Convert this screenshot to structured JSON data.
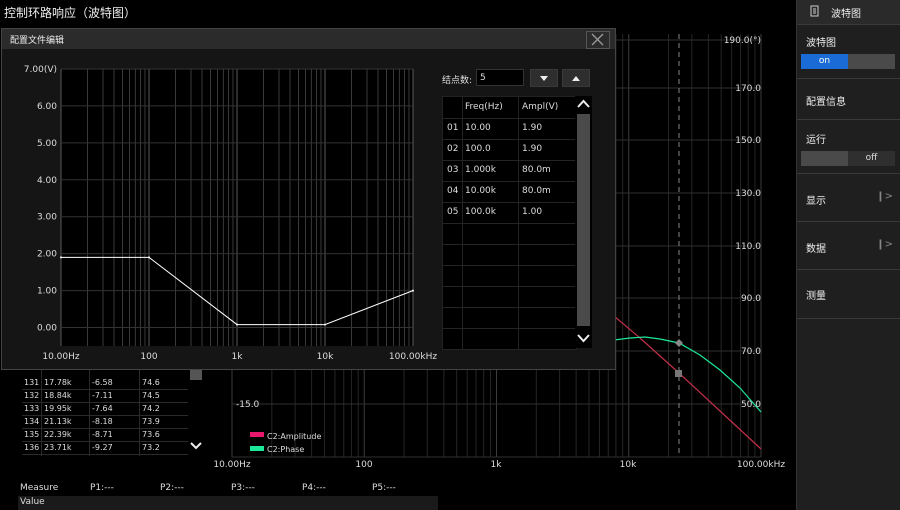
{
  "app": {
    "title": "控制环路响应（波特图）"
  },
  "right_panel": {
    "header": "波特图",
    "bode_section": {
      "label": "波特图",
      "toggle_on": "on"
    },
    "config_info": "配置信息",
    "run_section": {
      "label": "运行",
      "toggle_off": "off"
    },
    "display": "显示",
    "data": "数据",
    "measure": "测量"
  },
  "bode_plot": {
    "x_ticks": [
      "10.00Hz",
      "100",
      "1k",
      "10k",
      "100.00kHz"
    ],
    "phase_ticks": [
      "190.0(°)",
      "170.0",
      "150.0",
      "130.0",
      "110.0",
      "90.0",
      "70.0",
      "50.0"
    ],
    "amp_tick": "-15.0",
    "legend": [
      {
        "name": "C2:Amplitude",
        "color": "#e8186c"
      },
      {
        "name": "C2:Phase",
        "color": "#1de89a"
      }
    ],
    "amplitude_color": "#c0304a",
    "phase_color": "#1de89a"
  },
  "dialog": {
    "title": "配置文件编辑",
    "nodes_label": "结点数:",
    "nodes_value": "5",
    "y_ticks": [
      "7.00(V)",
      "6.00",
      "5.00",
      "4.00",
      "3.00",
      "2.00",
      "1.00",
      "0.00"
    ],
    "x_ticks": [
      "10.00Hz",
      "100",
      "1k",
      "10k",
      "100.00kHz"
    ],
    "table_headers": [
      "Freq(Hz)",
      "Ampl(V)"
    ],
    "nodes": [
      {
        "idx": "01",
        "freq": "10.00",
        "ampl": "1.90"
      },
      {
        "idx": "02",
        "freq": "100.0",
        "ampl": "1.90"
      },
      {
        "idx": "03",
        "freq": "1.000k",
        "ampl": "80.0m"
      },
      {
        "idx": "04",
        "freq": "10.00k",
        "ampl": "80.0m"
      },
      {
        "idx": "05",
        "freq": "100.0k",
        "ampl": "1.00"
      }
    ]
  },
  "chart_data": {
    "type": "line",
    "title": "",
    "xlabel": "",
    "ylabel": "",
    "x_scale": "log",
    "xlim": [
      10,
      100000
    ],
    "ylim": [
      -0.5,
      7
    ],
    "x_tick_labels": [
      "10.00Hz",
      "100",
      "1k",
      "10k",
      "100.00kHz"
    ],
    "y_tick_labels": [
      "7.00(V)",
      "6.00",
      "5.00",
      "4.00",
      "3.00",
      "2.00",
      "1.00",
      "0.00"
    ],
    "grid": true,
    "series": [
      {
        "x": [
          10,
          100,
          1000,
          10000,
          100000
        ],
        "values": [
          1.9,
          1.9,
          0.08,
          0.08,
          1.0
        ]
      }
    ]
  },
  "data_table": {
    "rows": [
      [
        "131",
        "17.78k",
        "-6.58",
        "74.6"
      ],
      [
        "132",
        "18.84k",
        "-7.11",
        "74.5"
      ],
      [
        "133",
        "19.95k",
        "-7.64",
        "74.2"
      ],
      [
        "134",
        "21.13k",
        "-8.18",
        "73.9"
      ],
      [
        "135",
        "22.39k",
        "-8.71",
        "73.6"
      ],
      [
        "136",
        "23.71k",
        "-9.27",
        "73.2"
      ]
    ]
  },
  "measure": {
    "label": "Measure",
    "value_label": "Value",
    "points": [
      "P1:---",
      "P2:---",
      "P3:---",
      "P4:---",
      "P5:---"
    ]
  }
}
